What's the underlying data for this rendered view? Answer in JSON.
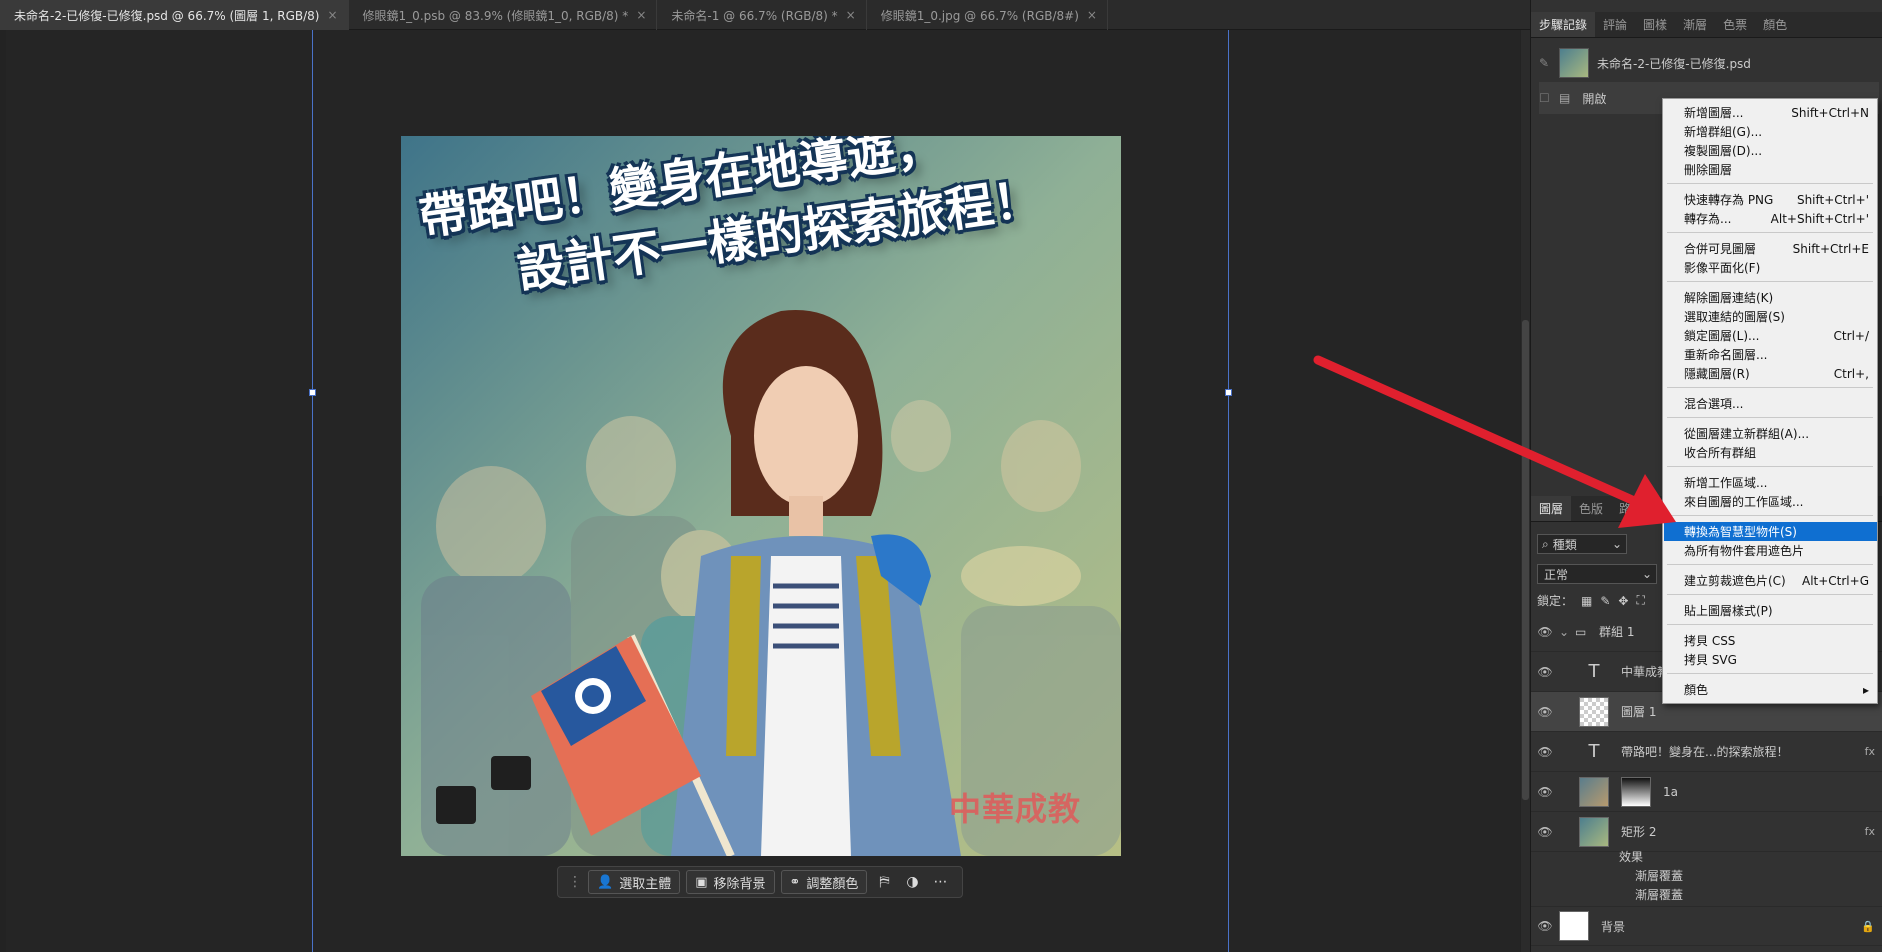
{
  "tabs": [
    {
      "label": "未命名-2-已修復-已修復.psd @ 66.7% (圖層 1, RGB/8)",
      "close": "×",
      "active": true
    },
    {
      "label": "修眼鏡1_0.psb @ 83.9% (修眼鏡1_0, RGB/8) *",
      "close": "×",
      "active": false
    },
    {
      "label": "未命名-1 @ 66.7% (RGB/8) *",
      "close": "×",
      "active": false
    },
    {
      "label": "修眼鏡1_0.jpg @ 66.7% (RGB/8#)",
      "close": "×",
      "active": false
    }
  ],
  "artwork": {
    "headline_line1": "帶路吧！變身在地導遊，",
    "headline_line2": "設計不一樣的探索旅程！",
    "watermark": "中華成教"
  },
  "contextual_toolbar": {
    "select_subject": "選取主體",
    "remove_bg": "移除背景",
    "adjust_color": "調整顏色",
    "more": "⋯"
  },
  "history_panel": {
    "tabs": [
      "步驟記錄",
      "評論",
      "圖樣",
      "漸層",
      "色票",
      "顏色"
    ],
    "snapshot": "未命名-2-已修復-已修復.psd",
    "state": "開啟"
  },
  "layers_panel": {
    "tabs": [
      "圖層",
      "色版",
      "路徑"
    ],
    "filter": "種類",
    "blend_mode": "正常",
    "lock_label": "鎖定：",
    "layers": [
      {
        "name": "群組 1",
        "type": "group"
      },
      {
        "name": "中華成教",
        "type": "text"
      },
      {
        "name": "圖層 1",
        "type": "pixel"
      },
      {
        "name": "帶路吧！變身在...的探索旅程！",
        "type": "text",
        "fx": "fx"
      },
      {
        "name": "1a",
        "type": "smart"
      },
      {
        "name": "矩形 2",
        "type": "shape",
        "fx": "fx"
      },
      {
        "name": "背景",
        "type": "background"
      }
    ],
    "effects_label": "效果",
    "effect1": "漸層覆蓋",
    "effect2": "漸層覆蓋"
  },
  "context_menu": {
    "items": [
      {
        "label": "新增圖層...",
        "shortcut": "Shift+Ctrl+N"
      },
      {
        "label": "新增群組(G)...",
        "shortcut": ""
      },
      {
        "label": "複製圖層(D)...",
        "shortcut": ""
      },
      {
        "label": "刪除圖層",
        "shortcut": ""
      },
      {
        "label": "快速轉存為 PNG",
        "shortcut": "Shift+Ctrl+'"
      },
      {
        "label": "轉存為...",
        "shortcut": "Alt+Shift+Ctrl+'"
      },
      {
        "label": "合併可見圖層",
        "shortcut": "Shift+Ctrl+E"
      },
      {
        "label": "影像平面化(F)",
        "shortcut": ""
      },
      {
        "label": "解除圖層連結(K)",
        "shortcut": ""
      },
      {
        "label": "選取連結的圖層(S)",
        "shortcut": ""
      },
      {
        "label": "鎖定圖層(L)...",
        "shortcut": "Ctrl+/"
      },
      {
        "label": "重新命名圖層...",
        "shortcut": ""
      },
      {
        "label": "隱藏圖層(R)",
        "shortcut": "Ctrl+,"
      },
      {
        "label": "混合選項...",
        "shortcut": ""
      },
      {
        "label": "從圖層建立新群組(A)...",
        "shortcut": ""
      },
      {
        "label": "收合所有群組",
        "shortcut": ""
      },
      {
        "label": "新增工作區域...",
        "shortcut": ""
      },
      {
        "label": "來自圖層的工作區域...",
        "shortcut": ""
      },
      {
        "label": "轉換為智慧型物件(S)",
        "shortcut": "",
        "highlighted": true
      },
      {
        "label": "為所有物件套用遮色片",
        "shortcut": ""
      },
      {
        "label": "建立剪裁遮色片(C)",
        "shortcut": "Alt+Ctrl+G"
      },
      {
        "label": "貼上圖層樣式(P)",
        "shortcut": ""
      },
      {
        "label": "拷貝 CSS",
        "shortcut": ""
      },
      {
        "label": "拷貝 SVG",
        "shortcut": ""
      },
      {
        "label": "顏色",
        "shortcut": "▸"
      }
    ]
  },
  "colors": {
    "highlight": "#0f6fd1",
    "annotation_arrow": "#e0202e",
    "guide": "#4a72c8"
  }
}
